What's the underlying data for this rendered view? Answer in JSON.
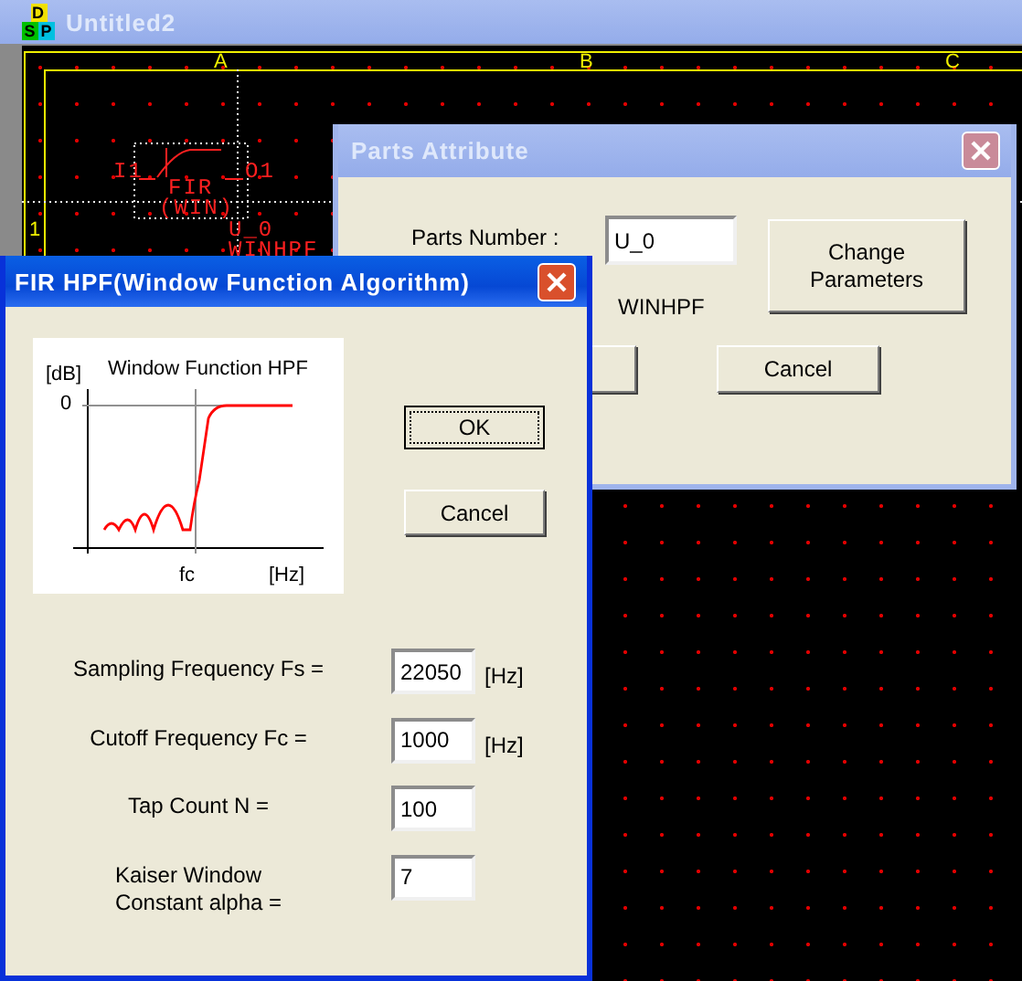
{
  "main_window": {
    "title": "Untitled2",
    "icon_letters": [
      "D",
      "S",
      "P"
    ],
    "active": false
  },
  "schematic": {
    "column_labels": [
      "A",
      "B",
      "C"
    ],
    "row_labels": [
      "1"
    ],
    "component": {
      "input_pin": "I1",
      "output_pin": "O1",
      "name": "FIR",
      "subtitle": "(WIN)",
      "reference": "U_0",
      "type": "WINHPF"
    }
  },
  "parts_dialog": {
    "title": "Parts Attribute",
    "active": false,
    "parts_number_label": "Parts Number :",
    "parts_number": "U_0",
    "change_button": "Change Parameters",
    "part_type": "WINHPF",
    "cancel_button": "Cancel"
  },
  "fir_dialog": {
    "title": "FIR HPF(Window Function Algorithm)",
    "active": true,
    "chart": {
      "title": "Window Function HPF",
      "y_unit": "[dB]",
      "y_tick": "0",
      "x_marker": "fc",
      "x_unit": "[Hz]"
    },
    "ok_button": {
      "label": "OK",
      "focused": true
    },
    "cancel_button": "Cancel",
    "fields": [
      {
        "label": "Sampling Frequency Fs =",
        "value": "22050",
        "unit": "[Hz]"
      },
      {
        "label": "Cutoff Frequency Fc =",
        "value": "1000",
        "unit": "[Hz]"
      },
      {
        "label": "Tap Count N =",
        "value": "100"
      },
      {
        "label": "Kaiser Window\nConstant alpha =",
        "value": "7"
      }
    ]
  }
}
